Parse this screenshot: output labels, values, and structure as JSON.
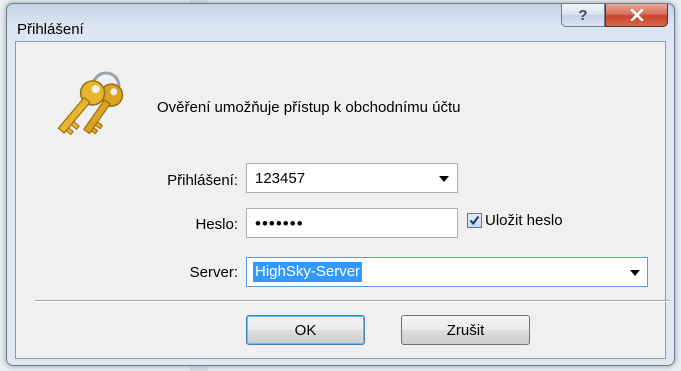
{
  "window": {
    "title": "Přihlášení",
    "help_glyph": "?",
    "close_glyph": "x"
  },
  "dialog": {
    "heading": "Ověření umožňuje přístup k obchodnímu účtu",
    "icon": "keys-icon"
  },
  "form": {
    "login_label": "Přihlášení:",
    "login_value": "123457",
    "password_label": "Heslo:",
    "password_mask": "•••••••",
    "save_password_label": "Uložit heslo",
    "save_password_checked": true,
    "server_label": "Server:",
    "server_value": "HighSky-Server"
  },
  "buttons": {
    "ok": "OK",
    "cancel": "Zrušit"
  },
  "colors": {
    "selection": "#3399ff",
    "close_button": "#c7432c",
    "title_bar": "#c3d4e7"
  }
}
